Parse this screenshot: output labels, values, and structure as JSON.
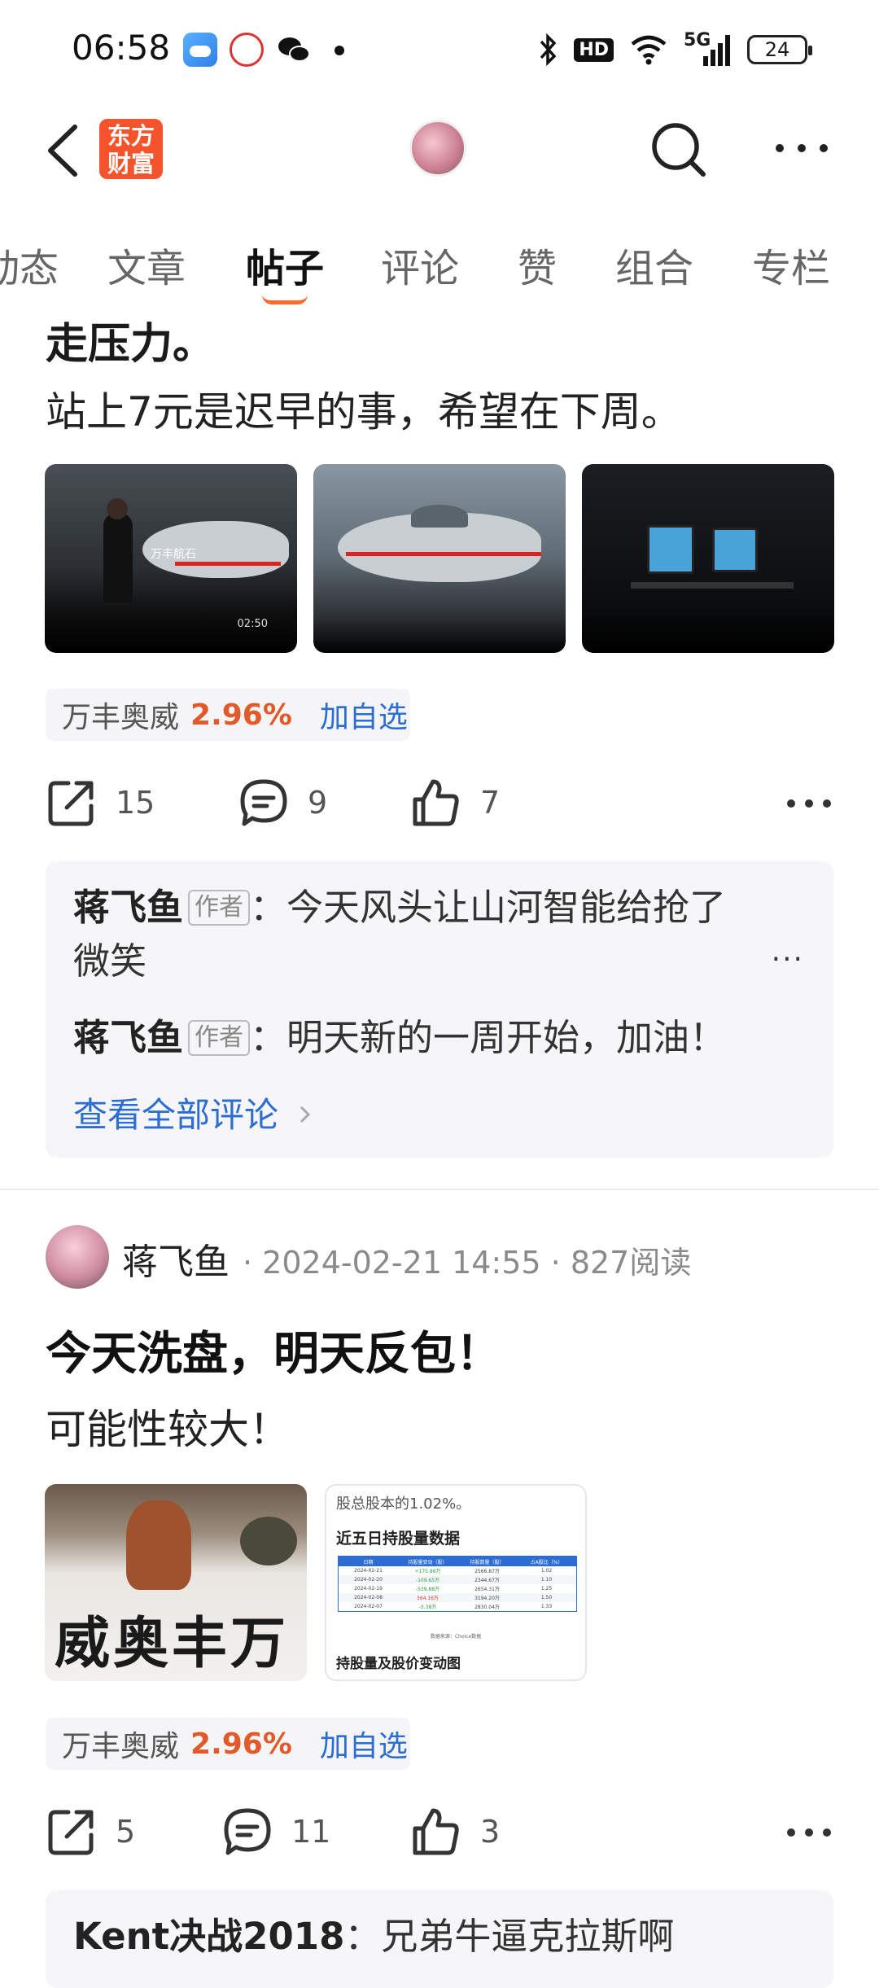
{
  "status_bar": {
    "time": "06:58",
    "network": "5G",
    "hd": "HD",
    "battery": "24"
  },
  "header": {
    "logo_text": "东方财富",
    "logo_line1": "东方",
    "logo_line2": "财富"
  },
  "tabs": [
    {
      "label": "动态"
    },
    {
      "label": "文章"
    },
    {
      "label": "帖子"
    },
    {
      "label": "评论"
    },
    {
      "label": "赞"
    },
    {
      "label": "组合"
    },
    {
      "label": "专栏"
    }
  ],
  "post1": {
    "partial_title": "走压力。",
    "text": "站上7元是迟早的事，希望在下周。",
    "image1_caption": "万丰航石",
    "video_duration": "02:50",
    "stock": {
      "name": "万丰奥威",
      "change": "2.96%",
      "add_label": "加自选"
    },
    "actions": {
      "share": "15",
      "comment": "9",
      "like": "7"
    },
    "comments": [
      {
        "author": "蒋飞鱼",
        "badge": "作者",
        "sep": "：",
        "text": "今天风头让山河智能给抢了",
        "text2": "微笑"
      },
      {
        "author": "蒋飞鱼",
        "badge": "作者",
        "sep": "：",
        "text": "明天新的一周开始，加油！"
      }
    ],
    "view_all": "查看全部评论",
    "more": "···"
  },
  "post2": {
    "author": "蒋飞鱼",
    "meta": "· 2024-02-21 14:55 · 827阅读",
    "title": "今天洗盘，明天反包！",
    "text": "可能性较大！",
    "calligraphy_text": "威奥丰万",
    "table_image": {
      "top_text": "股总股本的1.02%。",
      "heading": "近五日持股量数据",
      "columns": [
        "日期",
        "持股量变动（股）",
        "持股数量（股）",
        "占A股比（%）"
      ],
      "rows": [
        [
          "2024-02-21",
          "+175.86万",
          "2566.87万",
          "1.02"
        ],
        [
          "2024-02-20",
          "-109.65万",
          "2344.67万",
          "1.10"
        ],
        [
          "2024-02-19",
          "-539.88万",
          "2654.31万",
          "1.25"
        ],
        [
          "2024-02-08",
          "364.16万",
          "3194.20万",
          "1.50"
        ],
        [
          "2024-02-07",
          "-5.38万",
          "2830.04万",
          "1.33"
        ]
      ],
      "source": "数据来源：Choice数据",
      "footer": "持股量及股价变动图"
    },
    "stock": {
      "name": "万丰奥威",
      "change": "2.96%",
      "add_label": "加自选"
    },
    "actions": {
      "share": "5",
      "comment": "11",
      "like": "3"
    },
    "comments": [
      {
        "author": "Kent决战2018",
        "sep": "：",
        "text": "兄弟牛逼克拉斯啊"
      }
    ]
  },
  "colors": {
    "accent": "#ff6a2a",
    "stock_up": "#e05a2a",
    "link": "#2b6dd2",
    "logo_bg": "#f4532b"
  }
}
